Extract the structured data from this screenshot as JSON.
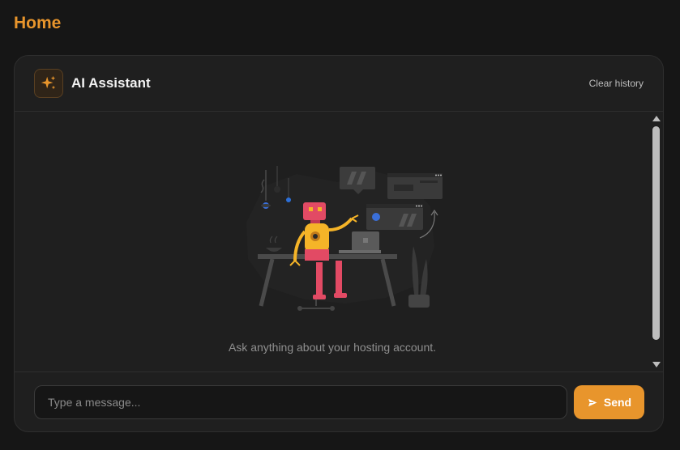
{
  "page": {
    "title": "Home"
  },
  "assistant": {
    "title": "AI Assistant",
    "icon": "sparkles-icon",
    "clear_label": "Clear history"
  },
  "chat": {
    "empty_message": "Ask anything about your hosting account."
  },
  "composer": {
    "placeholder": "Type a message...",
    "send_label": "Send",
    "send_icon": "send-icon"
  },
  "colors": {
    "accent": "#e8952c",
    "background": "#161616",
    "card": "#1f1f1f"
  }
}
